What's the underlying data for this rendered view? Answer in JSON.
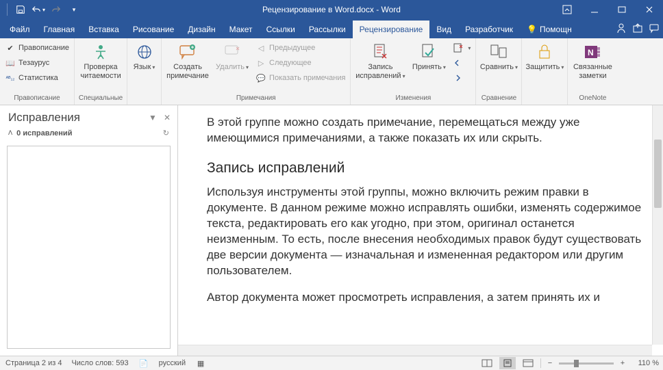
{
  "title": "Рецензирование в Word.docx - Word",
  "tabs": {
    "file": "Файл",
    "home": "Главная",
    "insert": "Вставка",
    "draw": "Рисование",
    "design": "Дизайн",
    "layout": "Макет",
    "references": "Ссылки",
    "mailings": "Рассылки",
    "review": "Рецензирование",
    "view": "Вид",
    "developer": "Разработчик",
    "help": "Помощн"
  },
  "ribbon": {
    "proofing": {
      "spelling": "Правописание",
      "thesaurus": "Тезаурус",
      "statistics": "Статистика",
      "group": "Правописание",
      "reading": "Проверка читаемости",
      "readingGroup": "Специальные",
      "language": "Язык"
    },
    "comments": {
      "new": "Создать примечание",
      "delete": "Удалить",
      "prev": "Предыдущее",
      "next": "Следующее",
      "show": "Показать примечания",
      "group": "Примечания"
    },
    "tracking": {
      "track": "Запись исправлений",
      "accept": "Принять",
      "group": "Изменения"
    },
    "compare": {
      "btn": "Сравнить",
      "group": "Сравнение"
    },
    "protect": {
      "btn": "Защитить"
    },
    "onenote": {
      "btn": "Связанные заметки",
      "group": "OneNote"
    }
  },
  "pane": {
    "title": "Исправления",
    "sub": "0 исправлений"
  },
  "doc": {
    "p1": "В этой группе можно создать примечание, перемещаться между уже имеющимися примечаниями, а также показать их или скрыть.",
    "h2": "Запись исправлений",
    "p2": "Используя инструменты этой группы, можно включить режим правки в документе. В данном режиме можно исправлять ошибки, изменять содержимое текста, редактировать его как угодно, при этом, оригинал останется неизменным. То есть, после внесения необходимых правок будут существовать две версии документа — изначальная и измененная редактором или другим пользователем.",
    "p3": "Автор документа может просмотреть исправления, а затем принять их и"
  },
  "status": {
    "page": "Страница 2 из 4",
    "words": "Число слов: 593",
    "lang": "русский",
    "zoom": "110 %"
  }
}
